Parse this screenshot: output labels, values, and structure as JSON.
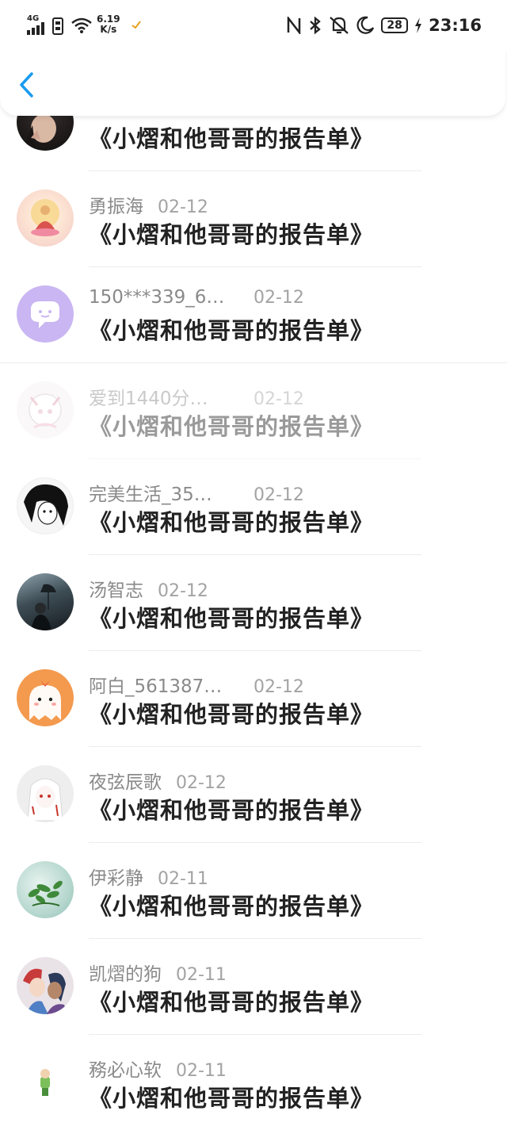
{
  "status_bar": {
    "network": "4G",
    "speed_value": "6.19",
    "speed_unit": "K/s",
    "battery": "28",
    "time": "23:16"
  },
  "items": [
    {
      "name": "",
      "date": "",
      "title": "《小熠和他哥哥的报告单》",
      "avatar": "photo-girl"
    },
    {
      "name": "勇振海",
      "date": "02-12",
      "title": "《小熠和他哥哥的报告单》",
      "avatar": "buddha"
    },
    {
      "name": "150***339_6…",
      "date": "02-12",
      "title": "《小熠和他哥哥的报告单》",
      "avatar": "purple-chat"
    },
    {
      "name": "爱到1440分…",
      "date": "02-12",
      "title": "《小熠和他哥哥的报告单》",
      "avatar": "anime-white-faded"
    },
    {
      "name": "完美生活_35…",
      "date": "02-12",
      "title": "《小熠和他哥哥的报告单》",
      "avatar": "anime-sketch"
    },
    {
      "name": "汤智志",
      "date": "02-12",
      "title": "《小熠和他哥哥的报告单》",
      "avatar": "dark-photo"
    },
    {
      "name": "阿白_561387…",
      "date": "02-12",
      "title": "《小熠和他哥哥的报告单》",
      "avatar": "orange-ghost"
    },
    {
      "name": "夜弦辰歌",
      "date": "02-12",
      "title": "《小熠和他哥哥的报告单》",
      "avatar": "anime-red-white"
    },
    {
      "name": "伊彩静",
      "date": "02-11",
      "title": "《小熠和他哥哥的报告单》",
      "avatar": "green-plants"
    },
    {
      "name": "凯熠的狗",
      "date": "02-11",
      "title": "《小熠和他哥哥的报告单》",
      "avatar": "anime-duo"
    },
    {
      "name": "務必心软",
      "date": "02-11",
      "title": "《小熠和他哥哥的报告单》",
      "avatar": "small-figure"
    }
  ],
  "colors": {
    "accent": "#1a9bf0",
    "name_gray": "#8a8a8a",
    "date_gray": "#a3a3a3",
    "title_dark": "#222222"
  }
}
